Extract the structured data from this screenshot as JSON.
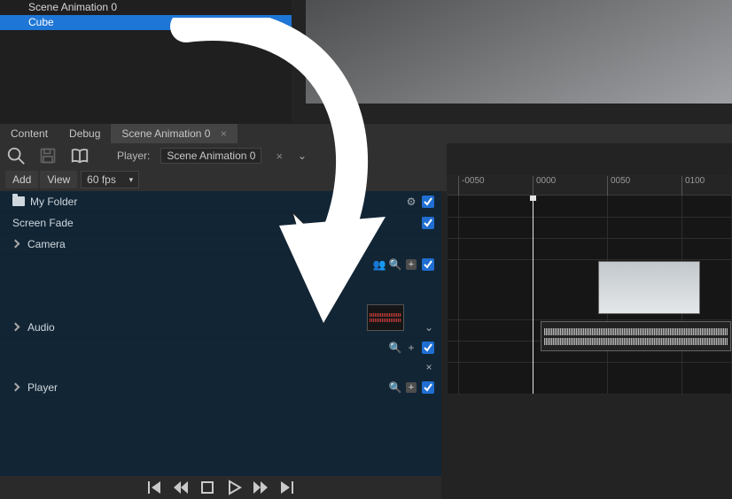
{
  "hierarchy": {
    "root_label": "Scene Animation 0",
    "selected_label": "Cube"
  },
  "tabs": {
    "content": "Content",
    "debug": "Debug",
    "active_label": "Scene Animation 0"
  },
  "toolbar": {
    "player_label": "Player:",
    "player_value": "Scene Animation 0",
    "add": "Add",
    "view": "View",
    "fps": "60 fps"
  },
  "outline": {
    "folder": "My Folder",
    "screen_fade": "Screen Fade",
    "camera": "Camera",
    "audio": "Audio",
    "player": "Player"
  },
  "timeline": {
    "ticks": [
      "-0050",
      "0000",
      "0050",
      "0100"
    ]
  },
  "icons": {
    "search": "search-icon",
    "save": "save-icon",
    "book": "book-icon",
    "close": "×",
    "chev_down": "⌄",
    "gear": "⚙",
    "magnify_sm": "🔍",
    "users": "👥",
    "plus": "+"
  }
}
